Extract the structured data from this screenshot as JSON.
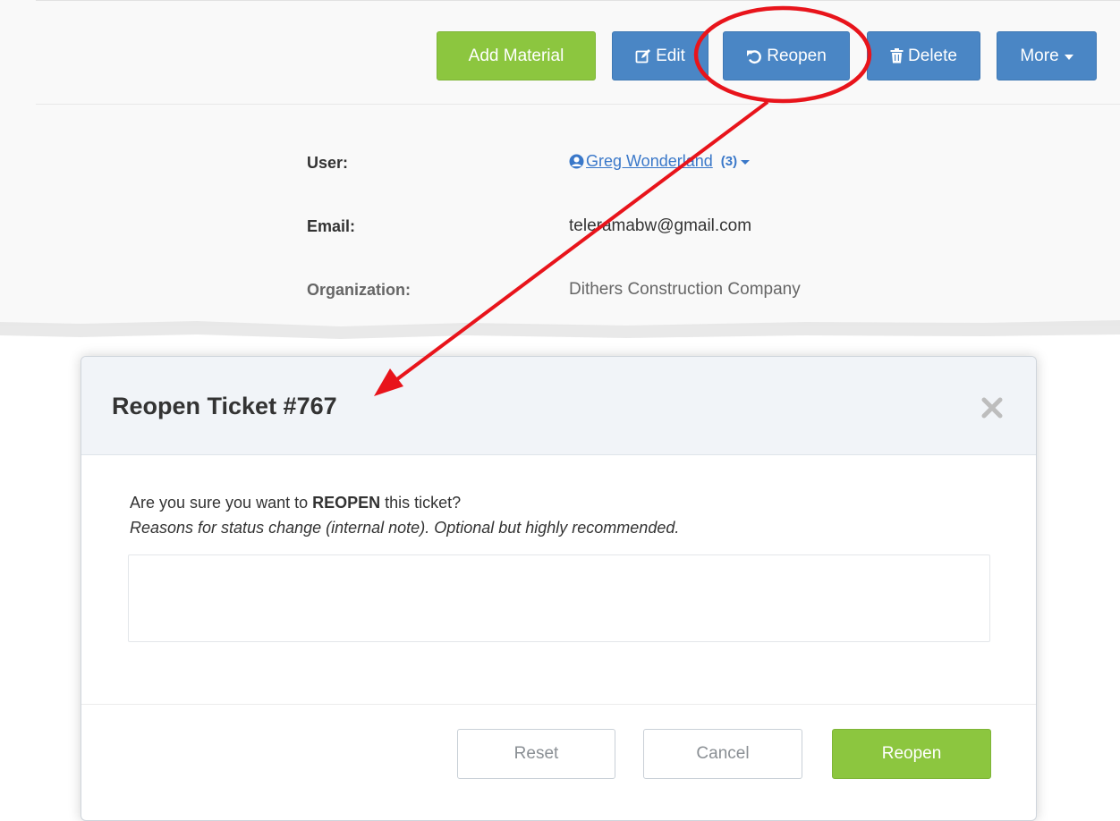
{
  "toolbar": {
    "add_material_label": "Add Material",
    "edit_label": "Edit",
    "reopen_label": "Reopen",
    "delete_label": "Delete",
    "more_label": "More"
  },
  "ticket_info": {
    "user_label": "User:",
    "user_name": "Greg Wonderland",
    "user_count": "(3)",
    "email_label": "Email:",
    "email_value": "teleramabw@gmail.com",
    "organization_label": "Organization:",
    "organization_value": "Dithers Construction Company"
  },
  "modal": {
    "title": "Reopen Ticket #767",
    "question_prefix": "Are you sure you want to ",
    "question_emphasis": "REOPEN",
    "question_suffix": " this ticket?",
    "note_hint": "Reasons for status change (internal note). Optional but highly recommended.",
    "textarea_value": "",
    "reset_label": "Reset",
    "cancel_label": "Cancel",
    "reopen_label": "Reopen"
  },
  "colors": {
    "green": "#8cc63f",
    "blue": "#4a86c5",
    "annotation_red": "#e8141b",
    "link_blue": "#3a78c9"
  }
}
